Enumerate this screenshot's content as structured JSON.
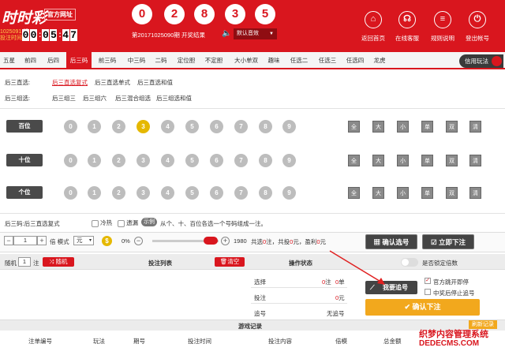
{
  "header": {
    "logo": "时时彩",
    "official": "官方网址",
    "issue_code": "1025091",
    "issue_suffix": "期",
    "issue_time_label": "投注时间",
    "countdown": [
      "0",
      "0",
      "0",
      "5",
      "4",
      "7"
    ],
    "result_balls": [
      "0",
      "2",
      "8",
      "3",
      "5"
    ],
    "issue_info": "第20171025090期 开奖结果",
    "sound": "默认音效",
    "top_icons": [
      {
        "label": "返回首页",
        "icon": "home-icon"
      },
      {
        "label": "在线客服",
        "icon": "headset-icon"
      },
      {
        "label": "规则说明",
        "icon": "list-icon"
      },
      {
        "label": "登出帐号",
        "icon": "power-icon"
      }
    ]
  },
  "tabs": [
    "五星",
    "前四",
    "后四",
    "后三码",
    "前三码",
    "中三码",
    "二码",
    "定位胆",
    "不定胆",
    "大小单双",
    "趣味",
    "任选二",
    "任选三",
    "任选四",
    "龙虎"
  ],
  "active_tab": "后三码",
  "credit_play": "信用玩法",
  "direct": {
    "label": "后三直选:",
    "items": [
      "后三直选复式",
      "后三直选单式",
      "后三直选和值"
    ]
  },
  "group": {
    "label": "后三组选:",
    "items": [
      "后三组三",
      "后三组六",
      "后三混合组选",
      "后三组选和值"
    ]
  },
  "positions": [
    {
      "name": "百位",
      "selected": "3"
    },
    {
      "name": "十位",
      "selected": ""
    },
    {
      "name": "个位",
      "selected": ""
    }
  ],
  "numbers": [
    "0",
    "1",
    "2",
    "3",
    "4",
    "5",
    "6",
    "7",
    "8",
    "9"
  ],
  "filters": [
    "全",
    "大",
    "小",
    "单",
    "双",
    "清"
  ],
  "info": {
    "title": "后三码:后三直选复式",
    "hot_cold": "冷热",
    "omission": "遗漏",
    "example": "示例",
    "hint": "从个、十、百位各选一个号码组成一注。"
  },
  "bet": {
    "multiple": "1",
    "times_label": "倍 模式",
    "mode": "元",
    "percent": "0%",
    "rate": "1980",
    "summary_1": "共选",
    "bets": "0",
    "summary_2": "注，共投",
    "amount": "0",
    "summary_3": "元，盈利",
    "profit": "0",
    "summary_4": "元",
    "confirm": "确认选号",
    "bet_now": "立即下注"
  },
  "list": {
    "random_label": "随机",
    "random_count": "1",
    "note_label": "注",
    "machine": "随机",
    "list_title": "投注列表",
    "clear": "清空",
    "status_title": "操作状态",
    "lock_label": "是否锁定倍数"
  },
  "stats": [
    {
      "label": "选择",
      "value": "0",
      "unit1": "注",
      "unit2": "0",
      "unit3": "单"
    },
    {
      "label": "投注",
      "value": "0",
      "unit1": "元"
    },
    {
      "label": "追号",
      "value": "无追号"
    }
  ],
  "chase": {
    "button": "我要追号",
    "official_stop": "官方跳开即停",
    "win_stop": "中奖后停止追号",
    "confirm_bet": "确认下注"
  },
  "records": {
    "title": "游戏记录",
    "refresh": "刷新记录",
    "columns": [
      "注单编号",
      "玩法",
      "期号",
      "投注时间",
      "投注内容",
      "倍模",
      "总金额"
    ]
  },
  "watermark": {
    "line1": "织梦内容管理系统",
    "line2": "DEDECMS.COM"
  }
}
